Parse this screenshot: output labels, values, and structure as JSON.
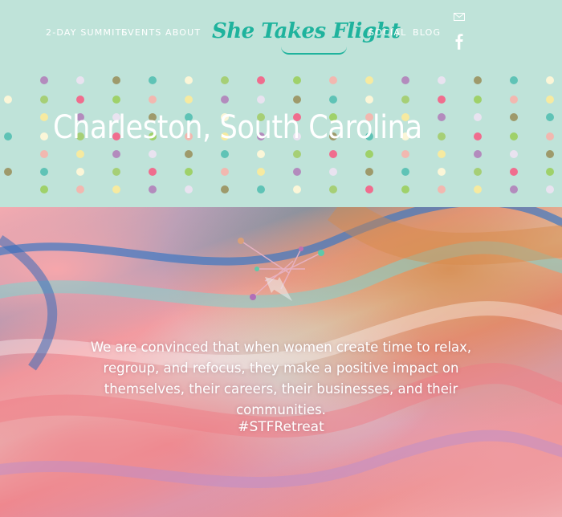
{
  "nav": {
    "items": [
      {
        "label": "2-DAY SUMMITS"
      },
      {
        "label": "EVENTS"
      },
      {
        "label": "ABOUT"
      },
      {
        "label": "SOCIAL"
      },
      {
        "label": "BLOG"
      }
    ],
    "logo_text": "She Takes Flight",
    "icons": [
      "mail-icon",
      "facebook-icon"
    ]
  },
  "hero": {
    "title": "Charleston, South Carolina",
    "dot_colors": [
      "#b38bbd",
      "#5fc3b6",
      "#f06d8e",
      "#f6eaa0",
      "#9e9a6b",
      "#a6cf76",
      "#f2b8b0",
      "#e9e3f0",
      "#fbf6d8",
      "#9fd16a"
    ]
  },
  "content": {
    "tagline": "We are convinced that when women create time to relax, regroup, and refocus, they make a positive impact on themselves, their careers, their businesses, and their communities.",
    "hashtag": "#STFRetreat"
  },
  "colors": {
    "background": "#bfe3d9",
    "accent": "#1fb39d",
    "text": "#ffffff"
  }
}
